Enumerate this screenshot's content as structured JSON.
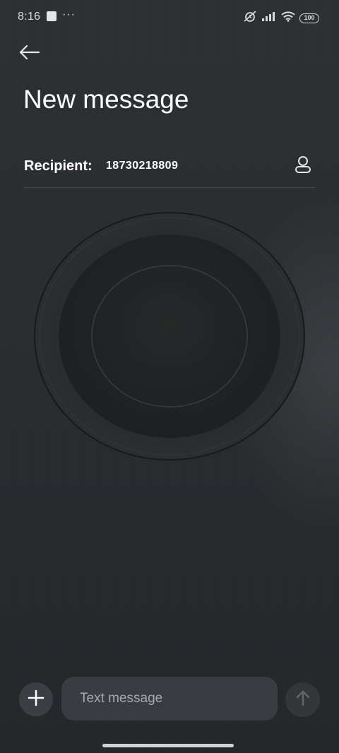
{
  "status_bar": {
    "time": "8:16",
    "more": "···",
    "battery": "100",
    "icons": [
      "app-notification-icon",
      "alarm-off-icon",
      "signal-icon",
      "wifi-icon",
      "battery-icon"
    ]
  },
  "header": {
    "back_icon": "back-arrow-icon",
    "title": "New message"
  },
  "recipient": {
    "label": "Recipient:",
    "value": "18730218809",
    "contact_icon": "contact-person-icon"
  },
  "composer": {
    "add_icon": "plus-icon",
    "placeholder": "Text message",
    "value": "",
    "send_icon": "arrow-up-icon"
  },
  "colors": {
    "background": "#2a2d30",
    "input_bg": "#393d41",
    "button_bg": "#3b3f43",
    "send_disabled": "#33373a",
    "divider": "#44484c"
  }
}
